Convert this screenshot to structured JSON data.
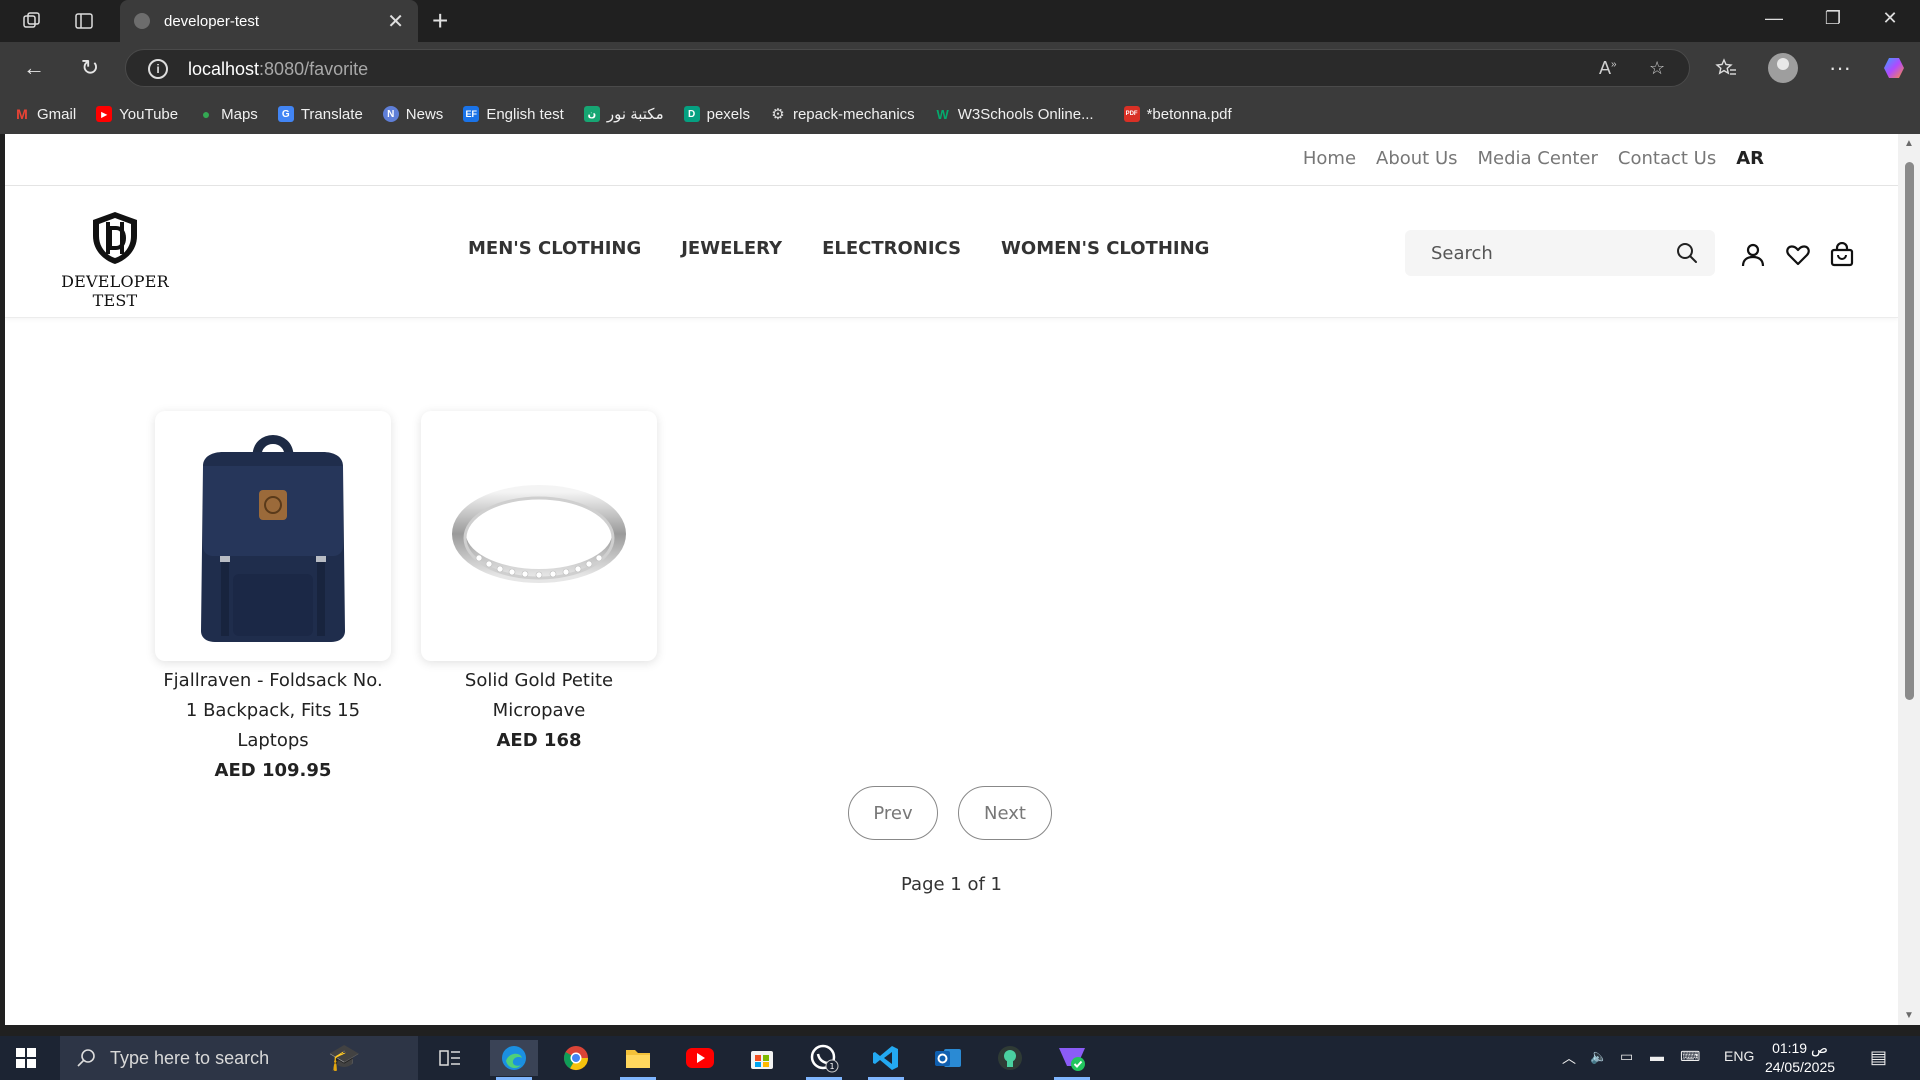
{
  "browser": {
    "tab_title": "developer-test",
    "address_host": "localhost",
    "address_path": ":8080/favorite",
    "bookmarks": [
      {
        "label": "Gmail",
        "icon": "gmail-icon",
        "color": "#ea4335",
        "glyph": "M"
      },
      {
        "label": "YouTube",
        "icon": "youtube-icon",
        "color": "#ff0000",
        "glyph": "▶"
      },
      {
        "label": "Maps",
        "icon": "maps-icon",
        "color": "#34a853",
        "glyph": "●"
      },
      {
        "label": "Translate",
        "icon": "translate-icon",
        "color": "#4285f4",
        "glyph": "G"
      },
      {
        "label": "News",
        "icon": "news-icon",
        "color": "#5f7fd8",
        "glyph": "N"
      },
      {
        "label": "English test",
        "icon": "ef-icon",
        "color": "#1a73e8",
        "glyph": "EF"
      },
      {
        "label": "مكتبة نور",
        "icon": "noor-library-icon",
        "color": "#17a673",
        "glyph": "ن"
      },
      {
        "label": "pexels",
        "icon": "pexels-icon",
        "color": "#05a081",
        "glyph": "D"
      },
      {
        "label": "repack-mechanics",
        "icon": "gear-icon",
        "color": "#555",
        "glyph": "⚙"
      },
      {
        "label": "W3Schools Online...",
        "icon": "w3schools-icon",
        "color": "#04aa6d",
        "glyph": "W"
      },
      {
        "label": "*betonna.pdf",
        "icon": "pdf-icon",
        "color": "#d93025",
        "glyph": "PDF"
      }
    ]
  },
  "site": {
    "top_links": [
      "Home",
      "About Us",
      "Media Center",
      "Contact Us"
    ],
    "lang_switch": "AR",
    "logo_text": "DEVELOPER TEST",
    "menu": [
      "MEN'S CLOTHING",
      "JEWELERY",
      "ELECTRONICS",
      "WOMEN'S CLOTHING"
    ],
    "search_placeholder": "Search"
  },
  "favorites": [
    {
      "title": "Fjallraven - Foldsack No. 1 Backpack, Fits 15 Laptops",
      "price": "AED 109.95",
      "image": "backpack"
    },
    {
      "title": "Solid Gold Petite Micropave",
      "price": "AED 168",
      "image": "ring"
    }
  ],
  "pagination": {
    "prev_label": "Prev",
    "next_label": "Next",
    "page_info": "Page 1 of 1"
  },
  "taskbar": {
    "search_placeholder": "Type here to search",
    "lang": "ENG",
    "time": "01:19 ص",
    "date": "24/05/2025"
  }
}
